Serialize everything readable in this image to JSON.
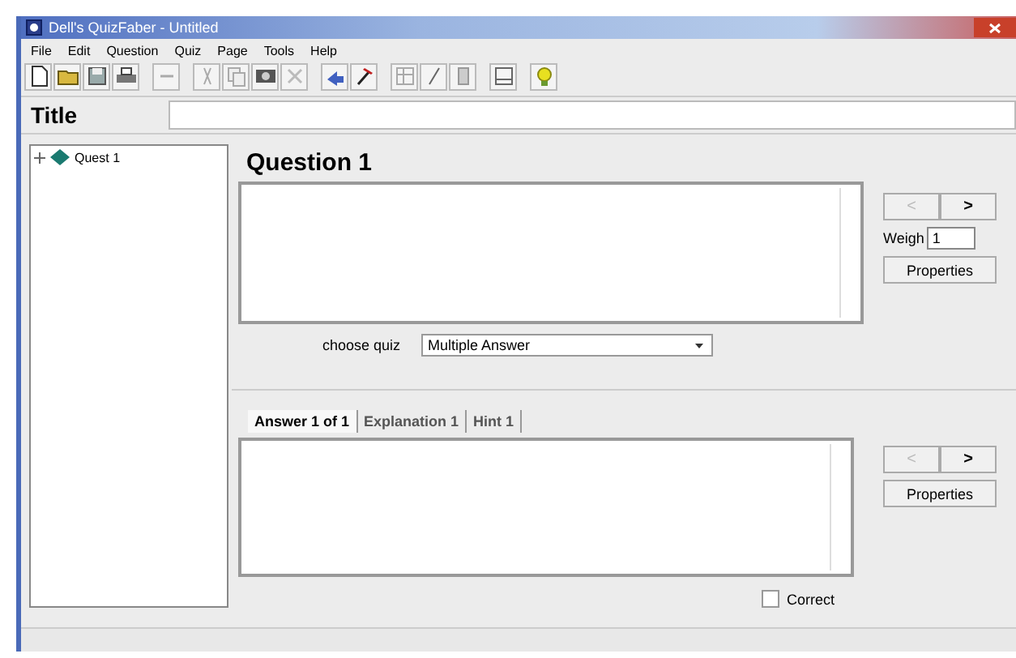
{
  "window": {
    "title": "Dell's QuizFaber - Untitled"
  },
  "menu": [
    "File",
    "Edit",
    "Question",
    "Quiz",
    "Page",
    "Tools",
    "Help"
  ],
  "title_field": {
    "label": "Title"
  },
  "tree": {
    "items": [
      {
        "label": "Quest 1",
        "expanded": false
      }
    ]
  },
  "question": {
    "heading": "Question 1",
    "weight_label": "Weigh",
    "weight": "1",
    "prev": "<",
    "next": ">",
    "properties": "Properties",
    "quiz_label": "choose quiz",
    "quiz_type": "Multiple Answer"
  },
  "tabs": [
    {
      "label": "Answer 1 of 1",
      "selected": true
    },
    {
      "label": "Explanation 1",
      "selected": false
    },
    {
      "label": "Hint 1",
      "selected": false
    }
  ],
  "answer": {
    "prev": "<",
    "next": ">",
    "properties": "Properties",
    "correct_label": "Correct",
    "correct": false
  }
}
